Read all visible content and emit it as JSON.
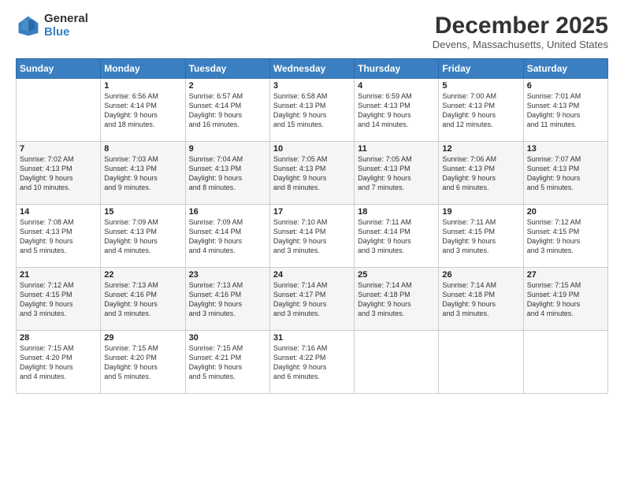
{
  "logo": {
    "general": "General",
    "blue": "Blue"
  },
  "header": {
    "month": "December 2025",
    "location": "Devens, Massachusetts, United States"
  },
  "days_of_week": [
    "Sunday",
    "Monday",
    "Tuesday",
    "Wednesday",
    "Thursday",
    "Friday",
    "Saturday"
  ],
  "weeks": [
    [
      {
        "day": "",
        "info": ""
      },
      {
        "day": "1",
        "info": "Sunrise: 6:56 AM\nSunset: 4:14 PM\nDaylight: 9 hours\nand 18 minutes."
      },
      {
        "day": "2",
        "info": "Sunrise: 6:57 AM\nSunset: 4:14 PM\nDaylight: 9 hours\nand 16 minutes."
      },
      {
        "day": "3",
        "info": "Sunrise: 6:58 AM\nSunset: 4:13 PM\nDaylight: 9 hours\nand 15 minutes."
      },
      {
        "day": "4",
        "info": "Sunrise: 6:59 AM\nSunset: 4:13 PM\nDaylight: 9 hours\nand 14 minutes."
      },
      {
        "day": "5",
        "info": "Sunrise: 7:00 AM\nSunset: 4:13 PM\nDaylight: 9 hours\nand 12 minutes."
      },
      {
        "day": "6",
        "info": "Sunrise: 7:01 AM\nSunset: 4:13 PM\nDaylight: 9 hours\nand 11 minutes."
      }
    ],
    [
      {
        "day": "7",
        "info": "Sunrise: 7:02 AM\nSunset: 4:13 PM\nDaylight: 9 hours\nand 10 minutes."
      },
      {
        "day": "8",
        "info": "Sunrise: 7:03 AM\nSunset: 4:13 PM\nDaylight: 9 hours\nand 9 minutes."
      },
      {
        "day": "9",
        "info": "Sunrise: 7:04 AM\nSunset: 4:13 PM\nDaylight: 9 hours\nand 8 minutes."
      },
      {
        "day": "10",
        "info": "Sunrise: 7:05 AM\nSunset: 4:13 PM\nDaylight: 9 hours\nand 8 minutes."
      },
      {
        "day": "11",
        "info": "Sunrise: 7:05 AM\nSunset: 4:13 PM\nDaylight: 9 hours\nand 7 minutes."
      },
      {
        "day": "12",
        "info": "Sunrise: 7:06 AM\nSunset: 4:13 PM\nDaylight: 9 hours\nand 6 minutes."
      },
      {
        "day": "13",
        "info": "Sunrise: 7:07 AM\nSunset: 4:13 PM\nDaylight: 9 hours\nand 5 minutes."
      }
    ],
    [
      {
        "day": "14",
        "info": "Sunrise: 7:08 AM\nSunset: 4:13 PM\nDaylight: 9 hours\nand 5 minutes."
      },
      {
        "day": "15",
        "info": "Sunrise: 7:09 AM\nSunset: 4:13 PM\nDaylight: 9 hours\nand 4 minutes."
      },
      {
        "day": "16",
        "info": "Sunrise: 7:09 AM\nSunset: 4:14 PM\nDaylight: 9 hours\nand 4 minutes."
      },
      {
        "day": "17",
        "info": "Sunrise: 7:10 AM\nSunset: 4:14 PM\nDaylight: 9 hours\nand 3 minutes."
      },
      {
        "day": "18",
        "info": "Sunrise: 7:11 AM\nSunset: 4:14 PM\nDaylight: 9 hours\nand 3 minutes."
      },
      {
        "day": "19",
        "info": "Sunrise: 7:11 AM\nSunset: 4:15 PM\nDaylight: 9 hours\nand 3 minutes."
      },
      {
        "day": "20",
        "info": "Sunrise: 7:12 AM\nSunset: 4:15 PM\nDaylight: 9 hours\nand 3 minutes."
      }
    ],
    [
      {
        "day": "21",
        "info": "Sunrise: 7:12 AM\nSunset: 4:15 PM\nDaylight: 9 hours\nand 3 minutes."
      },
      {
        "day": "22",
        "info": "Sunrise: 7:13 AM\nSunset: 4:16 PM\nDaylight: 9 hours\nand 3 minutes."
      },
      {
        "day": "23",
        "info": "Sunrise: 7:13 AM\nSunset: 4:16 PM\nDaylight: 9 hours\nand 3 minutes."
      },
      {
        "day": "24",
        "info": "Sunrise: 7:14 AM\nSunset: 4:17 PM\nDaylight: 9 hours\nand 3 minutes."
      },
      {
        "day": "25",
        "info": "Sunrise: 7:14 AM\nSunset: 4:18 PM\nDaylight: 9 hours\nand 3 minutes."
      },
      {
        "day": "26",
        "info": "Sunrise: 7:14 AM\nSunset: 4:18 PM\nDaylight: 9 hours\nand 3 minutes."
      },
      {
        "day": "27",
        "info": "Sunrise: 7:15 AM\nSunset: 4:19 PM\nDaylight: 9 hours\nand 4 minutes."
      }
    ],
    [
      {
        "day": "28",
        "info": "Sunrise: 7:15 AM\nSunset: 4:20 PM\nDaylight: 9 hours\nand 4 minutes."
      },
      {
        "day": "29",
        "info": "Sunrise: 7:15 AM\nSunset: 4:20 PM\nDaylight: 9 hours\nand 5 minutes."
      },
      {
        "day": "30",
        "info": "Sunrise: 7:15 AM\nSunset: 4:21 PM\nDaylight: 9 hours\nand 5 minutes."
      },
      {
        "day": "31",
        "info": "Sunrise: 7:16 AM\nSunset: 4:22 PM\nDaylight: 9 hours\nand 6 minutes."
      },
      {
        "day": "",
        "info": ""
      },
      {
        "day": "",
        "info": ""
      },
      {
        "day": "",
        "info": ""
      }
    ]
  ]
}
